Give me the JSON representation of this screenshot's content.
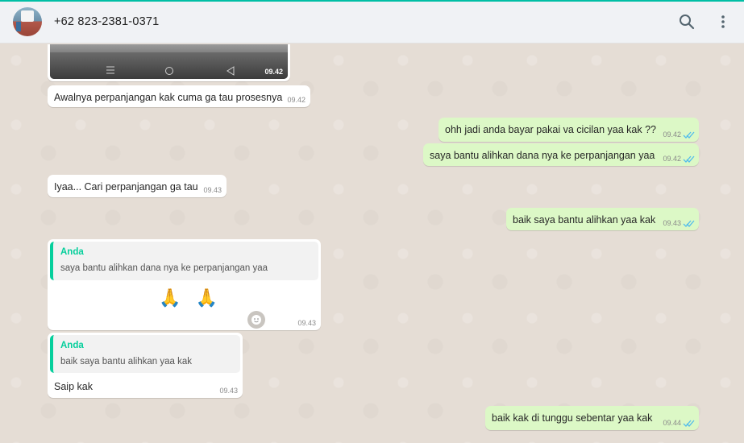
{
  "header": {
    "contact_name": "+62 823-2381-0371",
    "icons": [
      "search-icon",
      "more-vertical-icon"
    ]
  },
  "media_message": {
    "time": "09.42",
    "icons": [
      "menu-nav-icon",
      "home-nav-icon",
      "back-nav-icon"
    ]
  },
  "messages": [
    {
      "direction": "in",
      "text": "Awalnya perpanjangan kak cuma ga tau prosesnya",
      "time": "09.42"
    },
    {
      "direction": "out",
      "text": "ohh jadi anda bayar pakai va cicilan yaa kak ??",
      "time": "09.42",
      "status": "read"
    },
    {
      "direction": "out",
      "text": "saya bantu alihkan dana nya ke perpanjangan yaa",
      "time": "09.42",
      "status": "read"
    },
    {
      "direction": "in",
      "text": "Iyaa... Cari perpanjangan ga tau",
      "time": "09.43"
    },
    {
      "direction": "out",
      "text": "baik saya bantu alihkan yaa kak",
      "time": "09.43",
      "status": "read"
    },
    {
      "direction": "in",
      "quote_author": "Anda",
      "quote_text": "saya bantu alihkan dana nya ke perpanjangan yaa",
      "text": "🙏 🙏",
      "time": "09.43"
    },
    {
      "direction": "in",
      "quote_author": "Anda",
      "quote_text": "baik saya bantu alihkan yaa kak",
      "text": "Saip kak",
      "time": "09.43"
    },
    {
      "direction": "out",
      "text": "baik kak di tunggu sebentar yaa kak",
      "time": "09.44",
      "status": "read"
    }
  ],
  "colors": {
    "accent": "#06cf9c",
    "out_bubble": "#dcf8c6",
    "in_bubble": "#ffffff",
    "chat_bg": "#e5ddd5",
    "read_tick": "#53bdeb"
  }
}
